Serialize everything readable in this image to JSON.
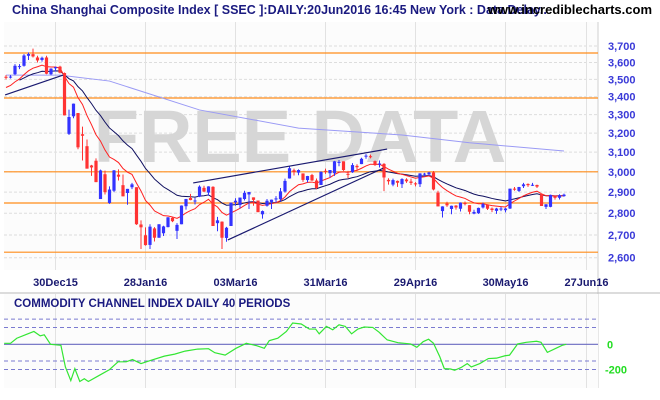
{
  "header": {
    "title": "China Shanghai Composite Index [ SSEC ]:DAILY:20Jun2016 16:45 New York : Data Delay..",
    "site": "www.incrediblecharts.com"
  },
  "watermark": "FREE DATA",
  "colors": {
    "up": "#3333ff",
    "down": "#ff3333",
    "ema_short": "#ff2020",
    "ema_long": "#101060",
    "ma_long": "#9a9af5",
    "support": "#ff8c1a",
    "trend": "#1a1a70",
    "cci": "#33e633",
    "cci_zero": "#6a6ac0"
  },
  "chart_data": [
    {
      "type": "candlestick",
      "title": "China Shanghai Composite Index [ SSEC ]:DAILY",
      "scale": "log",
      "ylim": [
        2560,
        3800
      ],
      "y_ticks": [
        "3,700",
        "3,600",
        "3,500",
        "3,400",
        "3,300",
        "3,200",
        "3,100",
        "3,000",
        "2,900",
        "2,800",
        "2,700",
        "2,600"
      ],
      "y_tick_values": [
        3700,
        3600,
        3500,
        3400,
        3300,
        3200,
        3100,
        3000,
        2900,
        2800,
        2700,
        2600
      ],
      "x_ticks": [
        {
          "label": "30Dec15",
          "day": 11
        },
        {
          "label": "28Jan16",
          "day": 31
        },
        {
          "label": "03Mar16",
          "day": 51
        },
        {
          "label": "31Mar16",
          "day": 71
        },
        {
          "label": "29Apr16",
          "day": 91
        },
        {
          "label": "30May16",
          "day": 111
        },
        {
          "label": "27Jun16",
          "day": 129
        }
      ],
      "x_range_days": [
        -0.5,
        131
      ],
      "ohlc": [
        [
          3515,
          3525,
          3500,
          3510
        ],
        [
          3512,
          3525,
          3505,
          3516
        ],
        [
          3530,
          3590,
          3525,
          3580
        ],
        [
          3575,
          3590,
          3560,
          3578
        ],
        [
          3580,
          3650,
          3575,
          3642
        ],
        [
          3640,
          3660,
          3615,
          3651
        ],
        [
          3650,
          3684,
          3630,
          3636
        ],
        [
          3630,
          3640,
          3600,
          3612
        ],
        [
          3615,
          3635,
          3605,
          3628
        ],
        [
          3630,
          3640,
          3530,
          3533
        ],
        [
          3530,
          3565,
          3525,
          3563
        ],
        [
          3565,
          3575,
          3545,
          3572
        ],
        [
          3575,
          3580,
          3535,
          3539
        ],
        [
          3537,
          3540,
          3295,
          3296
        ],
        [
          3196,
          3328,
          3190,
          3287
        ],
        [
          3291,
          3362,
          3280,
          3361
        ],
        [
          3309,
          3309,
          3115,
          3125
        ],
        [
          3194,
          3235,
          3057,
          3186
        ],
        [
          3131,
          3166,
          3016,
          3016
        ],
        [
          3032,
          3035,
          2980,
          3022
        ],
        [
          3056,
          3068,
          2949,
          2949
        ],
        [
          2867,
          3011,
          2867,
          3007
        ],
        [
          2988,
          3006,
          2889,
          2900
        ],
        [
          2848,
          2928,
          2844,
          2913
        ],
        [
          2907,
          3009,
          2900,
          3007
        ],
        [
          2986,
          3012,
          2957,
          2976
        ],
        [
          2934,
          2987,
          2880,
          2880
        ],
        [
          2896,
          2916,
          2840,
          2916
        ],
        [
          2924,
          2945,
          2915,
          2938
        ],
        [
          2924,
          2924,
          2746,
          2749
        ],
        [
          2748,
          2767,
          2638,
          2735
        ],
        [
          2699,
          2735,
          2653,
          2655
        ],
        [
          2656,
          2749,
          2638,
          2738
        ],
        [
          2730,
          2736,
          2671,
          2688
        ],
        [
          2688,
          2749,
          2688,
          2749
        ],
        [
          2708,
          2742,
          2696,
          2739
        ],
        [
          2736,
          2782,
          2735,
          2781
        ],
        [
          2779,
          2784,
          2759,
          2763
        ],
        [
          2719,
          2754,
          2682,
          2746
        ],
        [
          2749,
          2837,
          2749,
          2836
        ],
        [
          2833,
          2868,
          2817,
          2867
        ],
        [
          2872,
          2892,
          2861,
          2862
        ],
        [
          2856,
          2873,
          2841,
          2860
        ],
        [
          2878,
          2933,
          2876,
          2927
        ],
        [
          2921,
          2931,
          2900,
          2903
        ],
        [
          2898,
          2929,
          2883,
          2928
        ],
        [
          2926,
          2929,
          2741,
          2741
        ],
        [
          2754,
          2783,
          2717,
          2767
        ],
        [
          2761,
          2762,
          2638,
          2688
        ],
        [
          2687,
          2737,
          2670,
          2733
        ],
        [
          2741,
          2850,
          2741,
          2850
        ],
        [
          2851,
          2871,
          2835,
          2859
        ],
        [
          2839,
          2874,
          2823,
          2874
        ],
        [
          2867,
          2907,
          2860,
          2897
        ],
        [
          2889,
          2901,
          2820,
          2901
        ],
        [
          2875,
          2875,
          2835,
          2863
        ],
        [
          2860,
          2860,
          2805,
          2805
        ],
        [
          2795,
          2813,
          2775,
          2810
        ],
        [
          2835,
          2867,
          2831,
          2859
        ],
        [
          2853,
          2865,
          2820,
          2864
        ],
        [
          2865,
          2881,
          2850,
          2870
        ],
        [
          2866,
          2920,
          2856,
          2904
        ],
        [
          2903,
          2966,
          2898,
          2955
        ],
        [
          2967,
          3028,
          2966,
          3018
        ],
        [
          3008,
          3016,
          2982,
          2999
        ],
        [
          2996,
          3012,
          2983,
          3009
        ],
        [
          2992,
          2992,
          2950,
          2960
        ],
        [
          2959,
          2980,
          2948,
          2979
        ],
        [
          2984,
          2990,
          2955,
          2957
        ],
        [
          2957,
          2967,
          2914,
          2920
        ],
        [
          2935,
          3002,
          2935,
          3000
        ],
        [
          3005,
          3016,
          2990,
          3003
        ],
        [
          2993,
          3009,
          2971,
          3009
        ],
        [
          2993,
          3055,
          2980,
          3053
        ],
        [
          3045,
          3060,
          3028,
          3050
        ],
        [
          3053,
          3053,
          3005,
          3009
        ],
        [
          2990,
          3005,
          2969,
          2985
        ],
        [
          2998,
          3044,
          2995,
          3034
        ],
        [
          3030,
          3038,
          3005,
          3023
        ],
        [
          3039,
          3071,
          3039,
          3066
        ],
        [
          3077,
          3090,
          3066,
          3082
        ],
        [
          3079,
          3087,
          3068,
          3078
        ],
        [
          3054,
          3057,
          3030,
          3034
        ],
        [
          3036,
          3057,
          3022,
          3042
        ],
        [
          3040,
          3044,
          2905,
          2972
        ],
        [
          2960,
          2968,
          2937,
          2953
        ],
        [
          2937,
          2966,
          2929,
          2959
        ],
        [
          2955,
          2957,
          2926,
          2946
        ],
        [
          2939,
          2968,
          2920,
          2964
        ],
        [
          2962,
          2968,
          2945,
          2953
        ],
        [
          2952,
          2966,
          2935,
          2945
        ],
        [
          2943,
          2949,
          2928,
          2938
        ],
        [
          2939,
          2993,
          2925,
          2992
        ],
        [
          2987,
          2995,
          2977,
          2991
        ],
        [
          2987,
          3000,
          2982,
          2997
        ],
        [
          2997,
          3004,
          2909,
          2913
        ],
        [
          2898,
          2907,
          2832,
          2832
        ],
        [
          2810,
          2833,
          2780,
          2832
        ],
        [
          2846,
          2854,
          2830,
          2837
        ],
        [
          2820,
          2836,
          2795,
          2835
        ],
        [
          2836,
          2838,
          2817,
          2827
        ],
        [
          2821,
          2851,
          2808,
          2850
        ],
        [
          2849,
          2855,
          2837,
          2843
        ],
        [
          2838,
          2838,
          2795,
          2807
        ],
        [
          2798,
          2816,
          2795,
          2806
        ],
        [
          2800,
          2826,
          2797,
          2825
        ],
        [
          2827,
          2850,
          2822,
          2843
        ],
        [
          2839,
          2839,
          2815,
          2821
        ],
        [
          2822,
          2827,
          2805,
          2815
        ],
        [
          2811,
          2825,
          2797,
          2822
        ],
        [
          2819,
          2830,
          2810,
          2822
        ],
        [
          2814,
          2825,
          2804,
          2822
        ],
        [
          2822,
          2917,
          2820,
          2917
        ],
        [
          2917,
          2925,
          2907,
          2913
        ],
        [
          2906,
          2926,
          2901,
          2925
        ],
        [
          2929,
          2945,
          2920,
          2938
        ],
        [
          2940,
          2943,
          2926,
          2934
        ],
        [
          2936,
          2945,
          2930,
          2936
        ],
        [
          2935,
          2937,
          2920,
          2927
        ],
        [
          2890,
          2893,
          2834,
          2834
        ],
        [
          2830,
          2842,
          2820,
          2842
        ],
        [
          2830,
          2888,
          2828,
          2887
        ],
        [
          2881,
          2882,
          2864,
          2873
        ],
        [
          2873,
          2890,
          2865,
          2885
        ],
        [
          2881,
          2893,
          2878,
          2888
        ]
      ],
      "ema_seed": {
        "short": 3440,
        "long": 3470
      },
      "long_ma": [
        [
          0,
          3525
        ],
        [
          12,
          3525
        ],
        [
          23,
          3490
        ],
        [
          43,
          3326
        ],
        [
          65,
          3227
        ],
        [
          88,
          3190
        ],
        [
          103,
          3149
        ],
        [
          124,
          3106
        ]
      ],
      "support_levels": [
        3657,
        3393,
        3000,
        2848,
        2624
      ],
      "trendlines": [
        {
          "name": "early-uptrend",
          "from": [
            -0.2,
            3410
          ],
          "to": [
            12.7,
            3525
          ]
        },
        {
          "name": "channel-upper",
          "from": [
            41.6,
            2945
          ],
          "to": [
            84.7,
            3116
          ]
        },
        {
          "name": "channel-lower",
          "from": [
            49.3,
            2678
          ],
          "to": [
            83.8,
            3018
          ]
        }
      ]
    },
    {
      "type": "line",
      "title": "COMMODITY CHANNEL INDEX DAILY 40 PERIODS",
      "ylim": [
        -300,
        230
      ],
      "y_ticks": [
        "0",
        "-200"
      ],
      "y_tick_values": [
        0,
        -200
      ],
      "levels": [
        200,
        133,
        -133,
        -200
      ],
      "series": [
        {
          "name": "CCI 40",
          "x": [
            -0.4,
            1,
            2.4,
            4.3,
            6.2,
            7.6,
            8.5,
            9.9,
            12.2,
            13.2,
            14.4,
            15.3,
            16.4,
            17.4,
            18.3,
            20.7,
            23,
            24.9,
            26.7,
            28.1,
            30,
            32.3,
            35.2,
            37.5,
            39.8,
            42.6,
            45,
            46.4,
            48.7,
            51.1,
            53.4,
            55.7,
            57.4,
            58.5,
            60.4,
            62.3,
            63.7,
            65.6,
            67.4,
            68.8,
            69.6,
            71.2,
            72.6,
            74,
            75.4,
            76.8,
            78.2,
            79.6,
            81.5,
            82.9,
            84.7,
            87.1,
            88.5,
            89.9,
            91.3,
            92.7,
            93.9,
            95,
            96.4,
            97.4,
            98.8,
            99.7,
            101.1,
            102.5,
            103.4,
            105.3,
            107.2,
            109,
            110.9,
            111.9,
            113.7,
            115.6,
            117.9,
            118.9,
            120.3,
            122.2,
            123.6,
            124.5
          ],
          "values": [
            8,
            8,
            48,
            75,
            102,
            67,
            75,
            0,
            -8,
            -180,
            -288,
            -193,
            -295,
            -273,
            -295,
            -247,
            -201,
            -139,
            -139,
            -121,
            -153,
            -126,
            -94,
            -78,
            -54,
            -38,
            -35,
            -67,
            -86,
            -32,
            8,
            -11,
            -32,
            29,
            48,
            102,
            169,
            161,
            121,
            121,
            83,
            142,
            115,
            155,
            142,
            83,
            121,
            137,
            134,
            96,
            35,
            13,
            8,
            3,
            -24,
            21,
            40,
            8,
            -99,
            -193,
            -196,
            -206,
            -185,
            -153,
            -180,
            -153,
            -113,
            -110,
            -91,
            -86,
            3,
            16,
            24,
            16,
            -64,
            -32,
            -8,
            0
          ]
        }
      ]
    }
  ]
}
